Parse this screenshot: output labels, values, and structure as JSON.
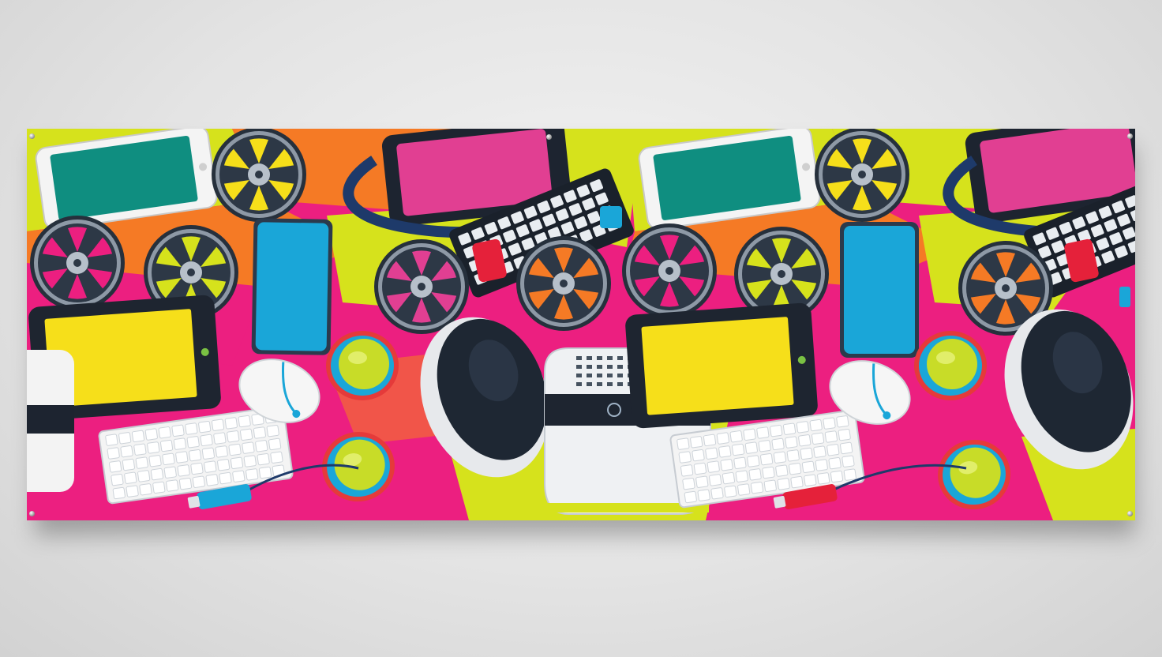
{
  "scene": {
    "subject": "printed-vinyl-banner",
    "wall_color": "#e6e6e6",
    "palette": {
      "magenta": "#ec1f80",
      "lime": "#d6e21c",
      "orange": "#f57a25",
      "cyan": "#1aa6d8",
      "yellow": "#f6df1a",
      "teal": "#0f8e80",
      "pink_screen": "#e13f92",
      "navy": "#1d2b3f",
      "white": "#f2f2f2"
    },
    "icons": [
      "smartphone-icon",
      "film-reel-icon",
      "tablet-icon",
      "keyboard-icon",
      "computer-mouse-icon",
      "headphones-icon",
      "speaker-icon",
      "usb-drive-icon"
    ]
  }
}
